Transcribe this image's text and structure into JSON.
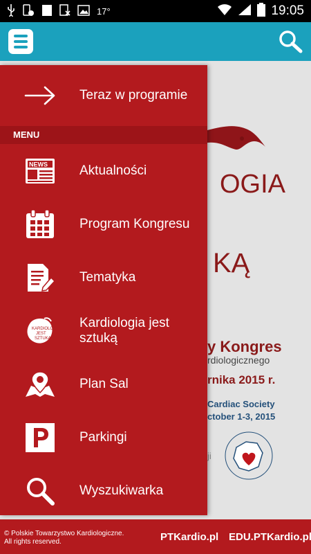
{
  "status_bar": {
    "time": "19:05",
    "temperature": "17°",
    "battery_badge": "100"
  },
  "drawer": {
    "header_label": "Teraz w programie",
    "section_title": "MENU",
    "items": [
      {
        "label": "Aktualności",
        "icon": "news-icon"
      },
      {
        "label": "Program Kongresu",
        "icon": "calendar-icon"
      },
      {
        "label": "Tematyka",
        "icon": "document-edit-icon"
      },
      {
        "label": "Kardiologia jest sztuką",
        "icon": "kardiologia-logo-icon"
      },
      {
        "label": "Plan Sal",
        "icon": "map-pin-icon"
      },
      {
        "label": "Parkingi",
        "icon": "parking-icon"
      },
      {
        "label": "Wyszukiwarka",
        "icon": "search-icon"
      }
    ]
  },
  "background": {
    "logo_text_1": "OGIA",
    "logo_text_2": "KĄ",
    "kongres_title": "y Kongres",
    "kongres_subtitle": "rdiologicznego",
    "date_pl": "rnika 2015 r.",
    "society": "Cardiac Society",
    "date_en": "ctober 1-3, 2015",
    "seal_text": "KARDIOLOGICZNE",
    "seal_text_2": "POLSKIE",
    "seal_text_3": "TOWARZYSTWO",
    "partial_text": "ji"
  },
  "footer": {
    "copyright_line1": "© Polskie Towarzystwo Kardiologiczne.",
    "copyright_line2": "All rights reserved.",
    "link1": "PTKardio.pl",
    "link2": "EDU.PTKardio.pl"
  },
  "colors": {
    "accent": "#1ba1bd",
    "drawer": "#b31a1e",
    "section": "#9d1418"
  }
}
